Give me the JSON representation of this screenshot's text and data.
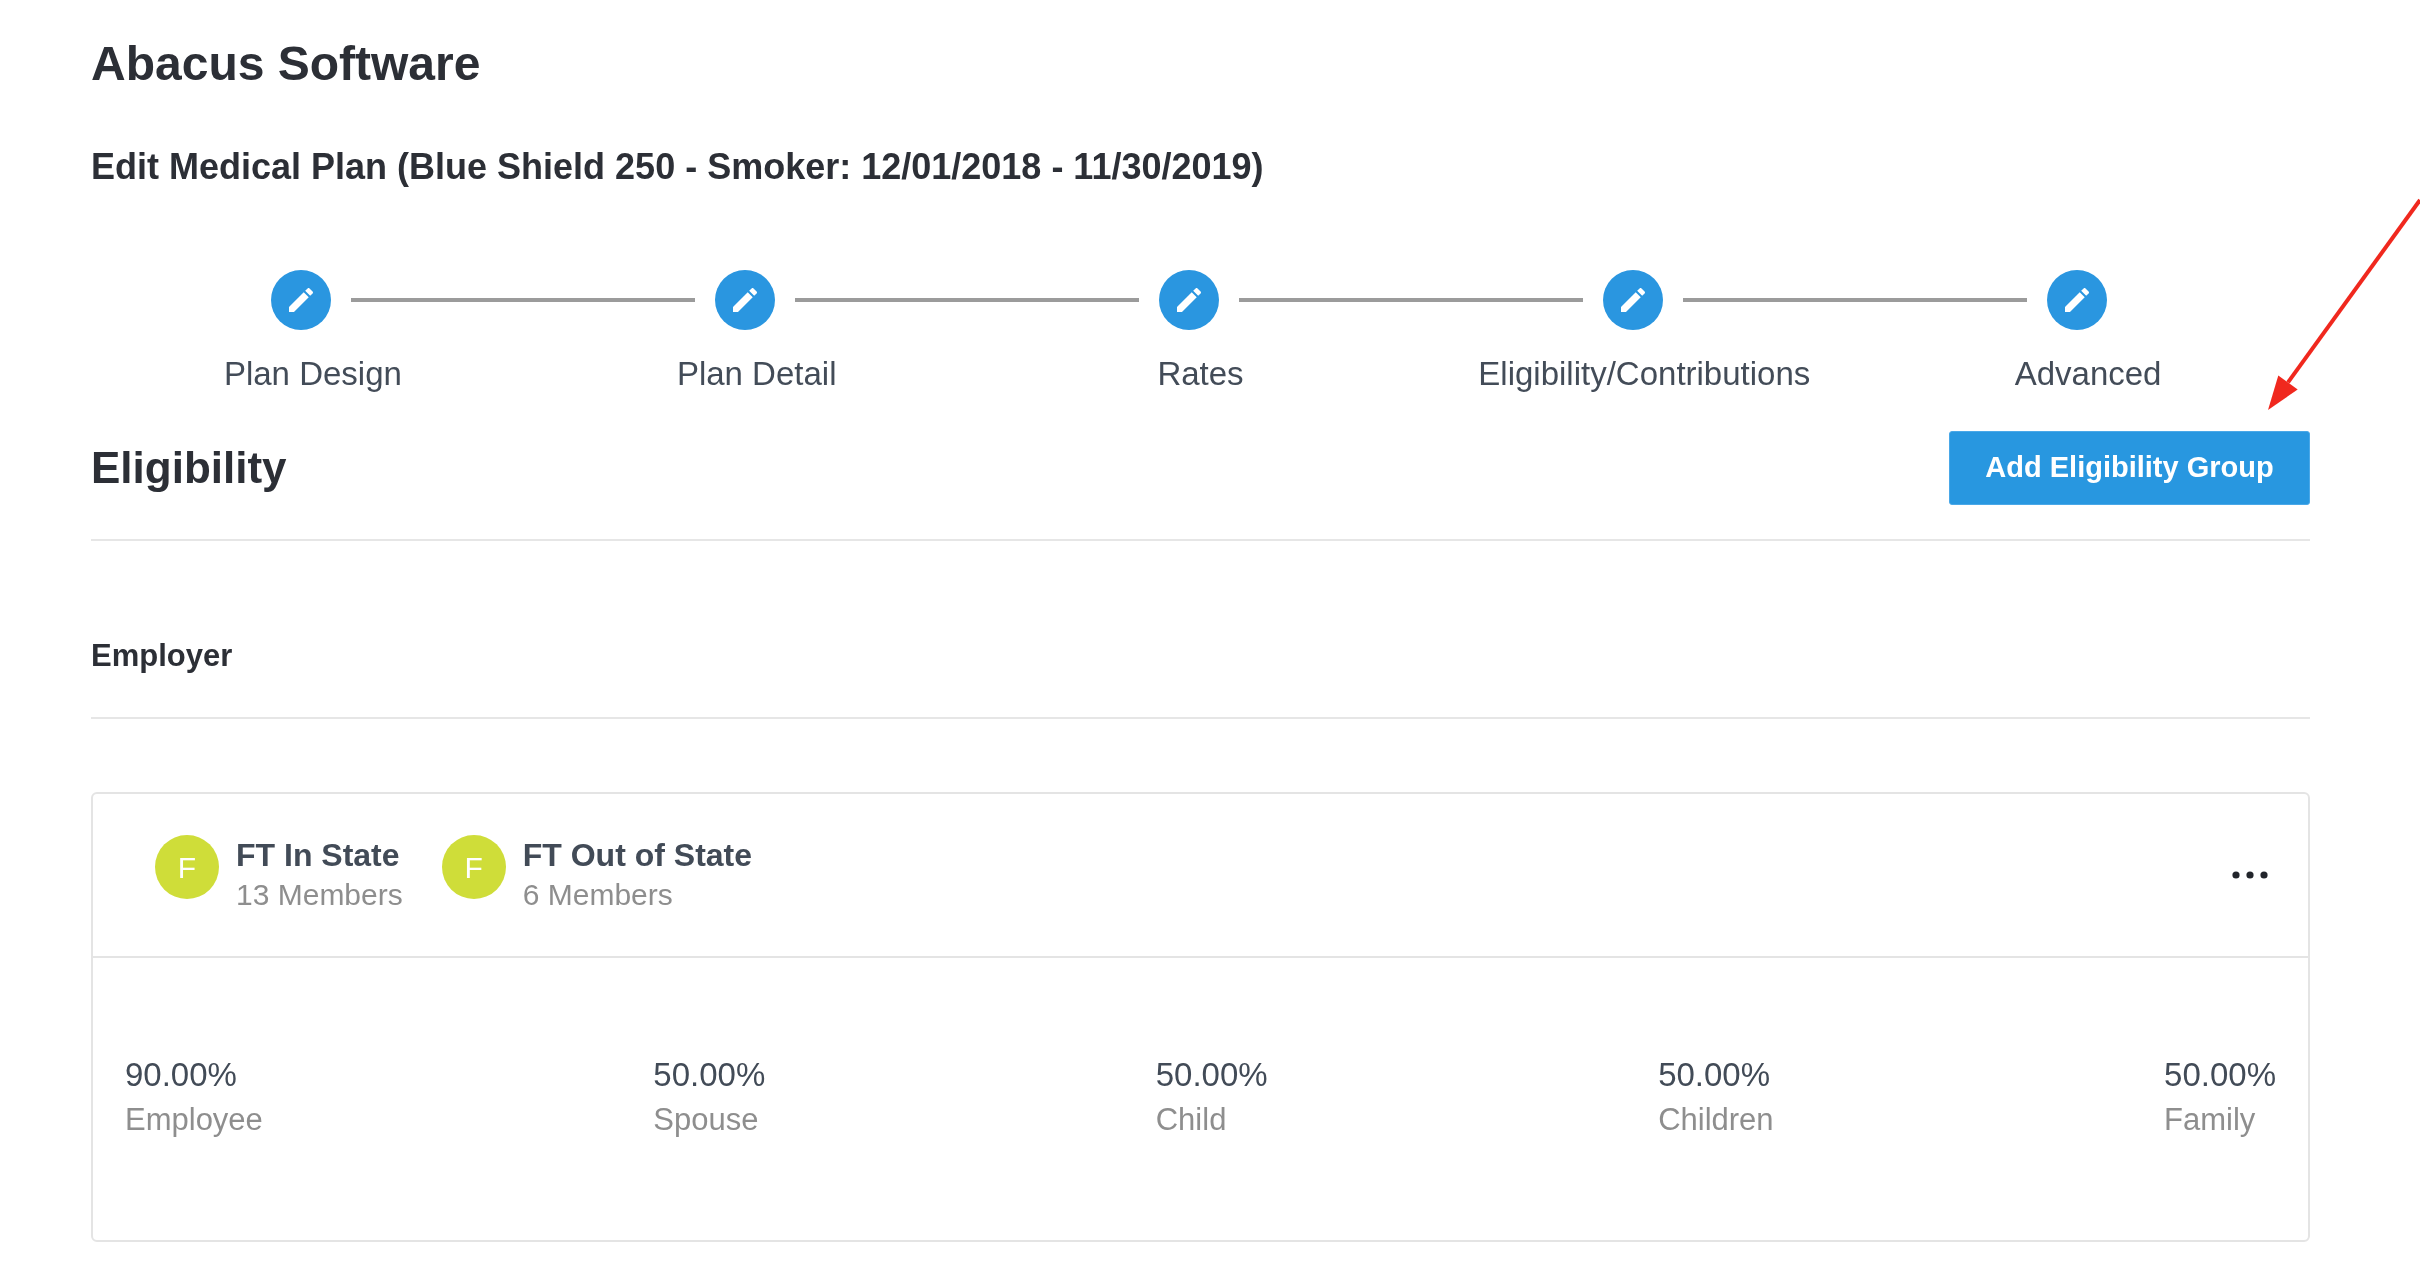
{
  "app": {
    "title": "Abacus Software"
  },
  "page": {
    "title": "Edit Medical Plan (Blue Shield 250 - Smoker: 12/01/2018 - 11/30/2019)"
  },
  "steps": [
    {
      "label": "Plan Design"
    },
    {
      "label": "Plan Detail"
    },
    {
      "label": "Rates"
    },
    {
      "label": "Eligibility/Contributions"
    },
    {
      "label": "Advanced"
    }
  ],
  "section": {
    "title": "Eligibility",
    "button": "Add Eligibility Group"
  },
  "employer": {
    "label": "Employer"
  },
  "group_card": {
    "groups": [
      {
        "initial": "F",
        "name": "FT In State",
        "members": "13 Members"
      },
      {
        "initial": "F",
        "name": "FT Out of State",
        "members": "6 Members"
      }
    ],
    "contributions": [
      {
        "value": "90.00%",
        "label": "Employee"
      },
      {
        "value": "50.00%",
        "label": "Spouse"
      },
      {
        "value": "50.00%",
        "label": "Child"
      },
      {
        "value": "50.00%",
        "label": "Children"
      },
      {
        "value": "50.00%",
        "label": "Family"
      }
    ]
  }
}
